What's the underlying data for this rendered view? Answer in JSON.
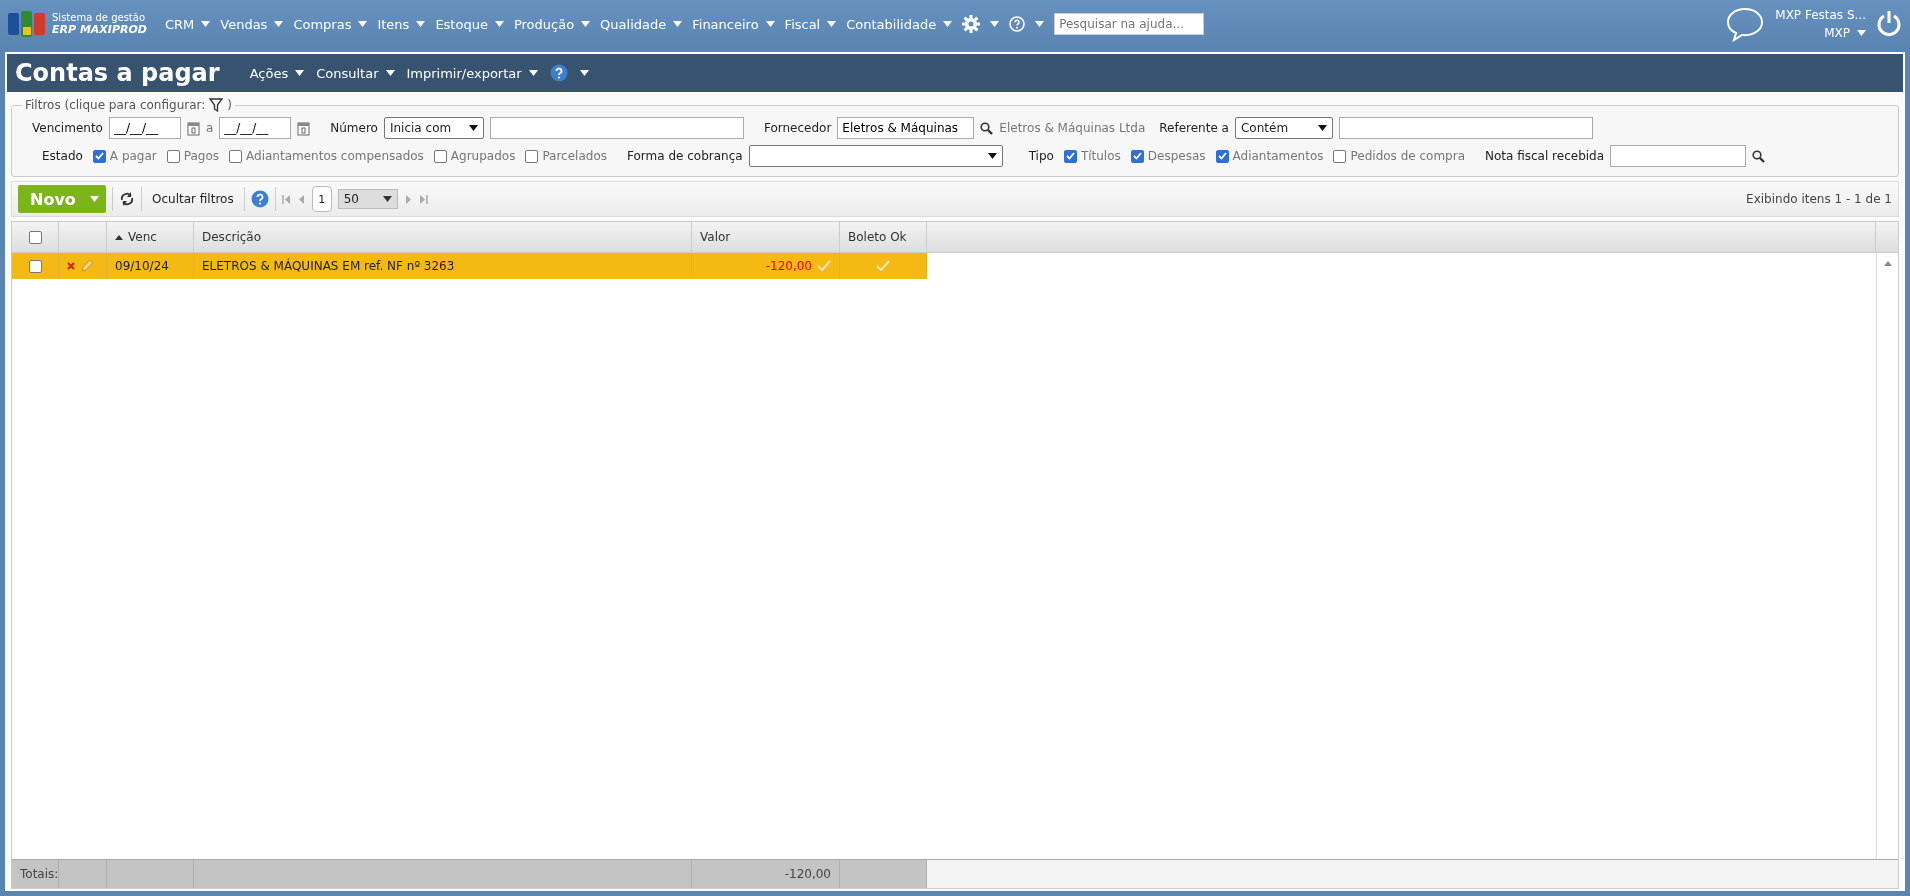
{
  "nav": {
    "logo_line1": "Sistema de gestão",
    "logo_line2": "ERP MAXIPROD",
    "menus": [
      "CRM",
      "Vendas",
      "Compras",
      "Itens",
      "Estoque",
      "Produção",
      "Qualidade",
      "Financeiro",
      "Fiscal",
      "Contabilidade"
    ],
    "search_placeholder": "Pesquisar na ajuda...",
    "user": "MXP Festas S...",
    "account": "MXP"
  },
  "page": {
    "title": "Contas a pagar",
    "menus": [
      "Ações",
      "Consultar",
      "Imprimir/exportar"
    ]
  },
  "filters": {
    "legend": "Filtros (clique para configurar:",
    "legend_end": ")",
    "vencimento": {
      "label": "Vencimento",
      "from": "__/__/__",
      "sep": "a",
      "to": "__/__/__"
    },
    "numero": {
      "label": "Número",
      "mode": "Inicia com"
    },
    "fornecedor": {
      "label": "Fornecedor",
      "value": "Eletros & Máquinas",
      "name": "Eletros & Máquinas Ltda"
    },
    "referente": {
      "label": "Referente a",
      "mode": "Contém"
    },
    "estado": {
      "label": "Estado",
      "options": [
        {
          "label": "A pagar",
          "checked": true
        },
        {
          "label": "Pagos",
          "checked": false
        },
        {
          "label": "Adiantamentos compensados",
          "checked": false
        },
        {
          "label": "Agrupados",
          "checked": false
        },
        {
          "label": "Parcelados",
          "checked": false
        }
      ]
    },
    "forma": {
      "label": "Forma de cobrança"
    },
    "tipo": {
      "label": "Tipo",
      "options": [
        {
          "label": "Títulos",
          "checked": true
        },
        {
          "label": "Despesas",
          "checked": true
        },
        {
          "label": "Adiantamentos",
          "checked": true
        },
        {
          "label": "Pedidos de compra",
          "checked": false
        }
      ]
    },
    "nota": {
      "label": "Nota fiscal recebida"
    }
  },
  "toolbar": {
    "new": "Novo",
    "hide_filters": "Ocultar filtros",
    "page": "1",
    "page_size": "50",
    "status": "Exibindo itens 1 - 1 de 1"
  },
  "table": {
    "header_checked": false,
    "columns": [
      {
        "label": "Venc",
        "sorted": true
      },
      {
        "label": "Descrição",
        "sorted": false
      },
      {
        "label": "Valor",
        "sorted": false
      },
      {
        "label": "Boleto Ok",
        "sorted": false
      }
    ],
    "rows": [
      {
        "selected": true,
        "checked": false,
        "venc": "09/10/24",
        "descricao": "ELETROS & MÁQUINAS EM ref. NF nº 3263",
        "valor": "-120,00"
      }
    ],
    "totals": {
      "label": "Totais:",
      "valor": "-120,00"
    }
  }
}
